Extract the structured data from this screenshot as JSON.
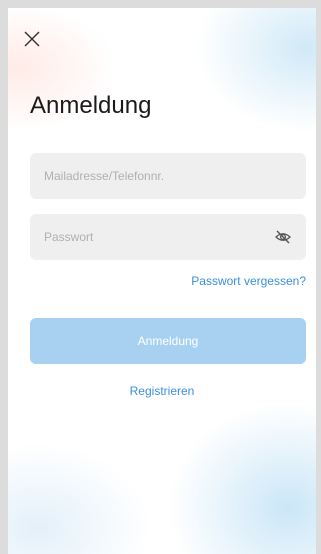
{
  "header": {
    "close_icon": "close-icon"
  },
  "title": "Anmeldung",
  "form": {
    "email_placeholder": "Mailadresse/Telefonnr.",
    "email_value": "",
    "password_placeholder": "Passwort",
    "password_value": "",
    "password_visibility_icon": "eye-off-icon",
    "forgot_password": "Passwort vergessen?",
    "submit_label": "Anmeldung",
    "register_label": "Registrieren"
  },
  "colors": {
    "accent": "#3b8fdc",
    "button_disabled": "#a8d1f1",
    "field_bg": "#efefef",
    "title": "#1a1a1a"
  }
}
